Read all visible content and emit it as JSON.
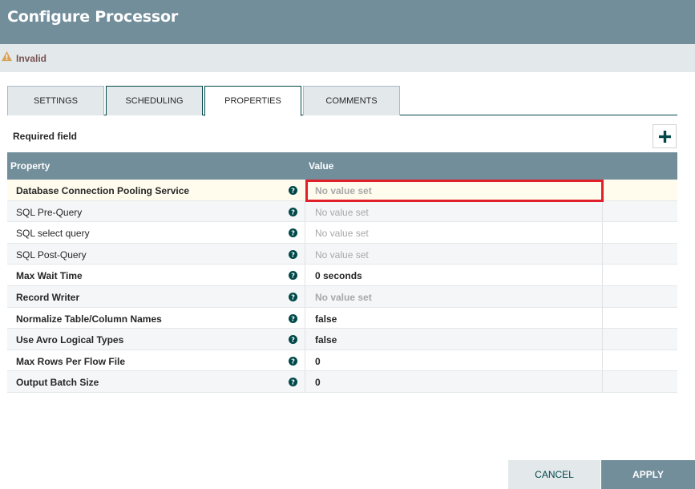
{
  "dialog": {
    "title": "Configure Processor"
  },
  "status": {
    "text": "Invalid",
    "icon": "warning-icon",
    "icon_color": "#d8a25b"
  },
  "tabs": [
    {
      "label": "SETTINGS",
      "selected": false
    },
    {
      "label": "SCHEDULING",
      "selected": false
    },
    {
      "label": "PROPERTIES",
      "selected": true
    },
    {
      "label": "COMMENTS",
      "selected": false
    }
  ],
  "properties_panel": {
    "required_label": "Required field",
    "add_icon": "plus-icon",
    "columns": {
      "property": "Property",
      "value": "Value"
    },
    "rows": [
      {
        "name": "Database Connection Pooling Service",
        "value": "No value set",
        "required": true,
        "unset": true,
        "highlighted": true
      },
      {
        "name": "SQL Pre-Query",
        "value": "No value set",
        "required": false,
        "unset": true
      },
      {
        "name": "SQL select query",
        "value": "No value set",
        "required": false,
        "unset": true
      },
      {
        "name": "SQL Post-Query",
        "value": "No value set",
        "required": false,
        "unset": true
      },
      {
        "name": "Max Wait Time",
        "value": "0 seconds",
        "required": true,
        "unset": false
      },
      {
        "name": "Record Writer",
        "value": "No value set",
        "required": true,
        "unset": true
      },
      {
        "name": "Normalize Table/Column Names",
        "value": "false",
        "required": true,
        "unset": false
      },
      {
        "name": "Use Avro Logical Types",
        "value": "false",
        "required": true,
        "unset": false
      },
      {
        "name": "Max Rows Per Flow File",
        "value": "0",
        "required": true,
        "unset": false
      },
      {
        "name": "Output Batch Size",
        "value": "0",
        "required": true,
        "unset": false
      }
    ]
  },
  "footer": {
    "cancel_label": "CANCEL",
    "apply_label": "APPLY"
  },
  "colors": {
    "header": "#728e9b",
    "accent": "#004849",
    "highlight_border": "#e0202a"
  }
}
